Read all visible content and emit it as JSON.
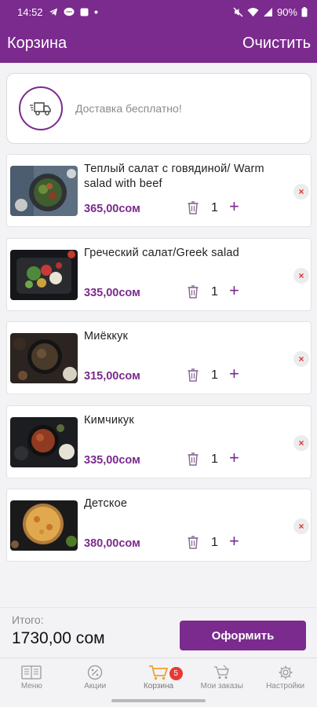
{
  "status_bar": {
    "time": "14:52",
    "battery": "90%"
  },
  "header": {
    "title": "Корзина",
    "clear_label": "Очистить"
  },
  "delivery": {
    "text": "Доставка бесплатно!"
  },
  "cart": {
    "items": [
      {
        "name": "Теплый салат с говядиной/ Warm salad with beef",
        "price": "365,00сом",
        "quantity": "1"
      },
      {
        "name": "Греческий салат/Greek salad",
        "price": "335,00сом",
        "quantity": "1"
      },
      {
        "name": "Миёккук",
        "price": "315,00сом",
        "quantity": "1"
      },
      {
        "name": "Кимчикук",
        "price": "335,00сом",
        "quantity": "1"
      },
      {
        "name": "Детское",
        "price": "380,00сом",
        "quantity": "1"
      }
    ],
    "plus_symbol": "+",
    "remove_symbol": "×"
  },
  "summary": {
    "total_label": "Итого:",
    "total_value": "1730,00 сом",
    "checkout_label": "Оформить"
  },
  "tabbar": {
    "tabs": [
      {
        "label": "Меню",
        "icon": "menu-book-icon"
      },
      {
        "label": "Акции",
        "icon": "percent-icon"
      },
      {
        "label": "Корзина",
        "icon": "cart-icon",
        "badge": "5"
      },
      {
        "label": "Мои заказы",
        "icon": "orders-icon"
      },
      {
        "label": "Настройки",
        "icon": "gear-icon"
      }
    ]
  },
  "colors": {
    "brand": "#7b2a8e",
    "badge": "#e53935",
    "remove": "#d63a3a"
  }
}
